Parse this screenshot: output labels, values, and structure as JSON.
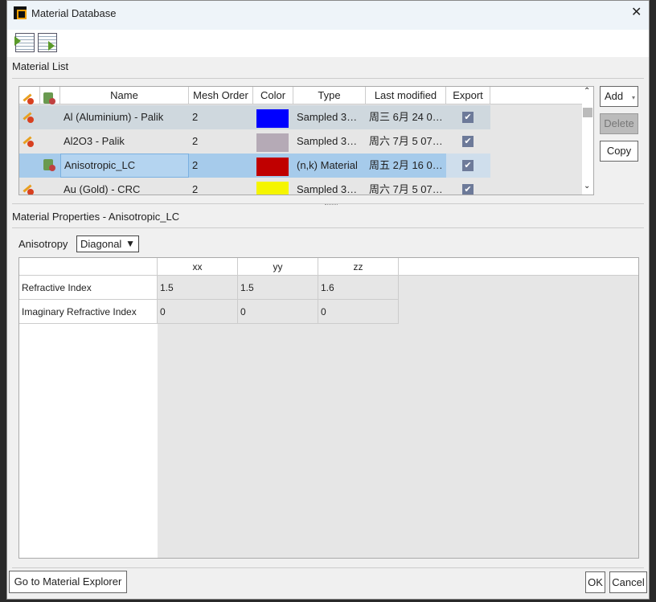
{
  "window": {
    "title": "Material Database"
  },
  "toolbar": {
    "import_icon": "import-table-icon",
    "export_icon": "export-table-icon"
  },
  "material_list": {
    "label": "Material List",
    "columns": [
      "Name",
      "Mesh Order",
      "Color",
      "Type",
      "Last modified",
      "Export"
    ],
    "rows": [
      {
        "name": "Al (Aluminium) - Palik",
        "mesh_order": "2",
        "color": "#0000ff",
        "type": "Sampled 3…",
        "last_modified": "周三 6月 24 0…",
        "export": true
      },
      {
        "name": "Al2O3 - Palik",
        "mesh_order": "2",
        "color": "#b5aab6",
        "type": "Sampled 3…",
        "last_modified": "周六 7月 5 07…",
        "export": true
      },
      {
        "name": "Anisotropic_LC",
        "mesh_order": "2",
        "color": "#c00000",
        "type": "(n,k) Material",
        "last_modified": "周五 2月 16 0…",
        "export": true
      },
      {
        "name": "Au (Gold) - CRC",
        "mesh_order": "2",
        "color": "#f5f500",
        "type": "Sampled 3…",
        "last_modified": "周六 7月 5 07…",
        "export": true
      }
    ],
    "buttons": {
      "add": "Add",
      "delete": "Delete",
      "copy": "Copy"
    }
  },
  "properties": {
    "label": "Material Properties - Anisotropic_LC",
    "anisotropy_label": "Anisotropy",
    "anisotropy_value": "Diagonal",
    "columns": [
      "xx",
      "yy",
      "zz"
    ],
    "rows": [
      {
        "label": "Refractive Index",
        "values": [
          "1.5",
          "1.5",
          "1.6"
        ]
      },
      {
        "label": "Imaginary Refractive Index",
        "values": [
          "0",
          "0",
          "0"
        ]
      }
    ]
  },
  "footer": {
    "explorer": "Go to Material Explorer",
    "ok": "OK",
    "cancel": "Cancel"
  }
}
